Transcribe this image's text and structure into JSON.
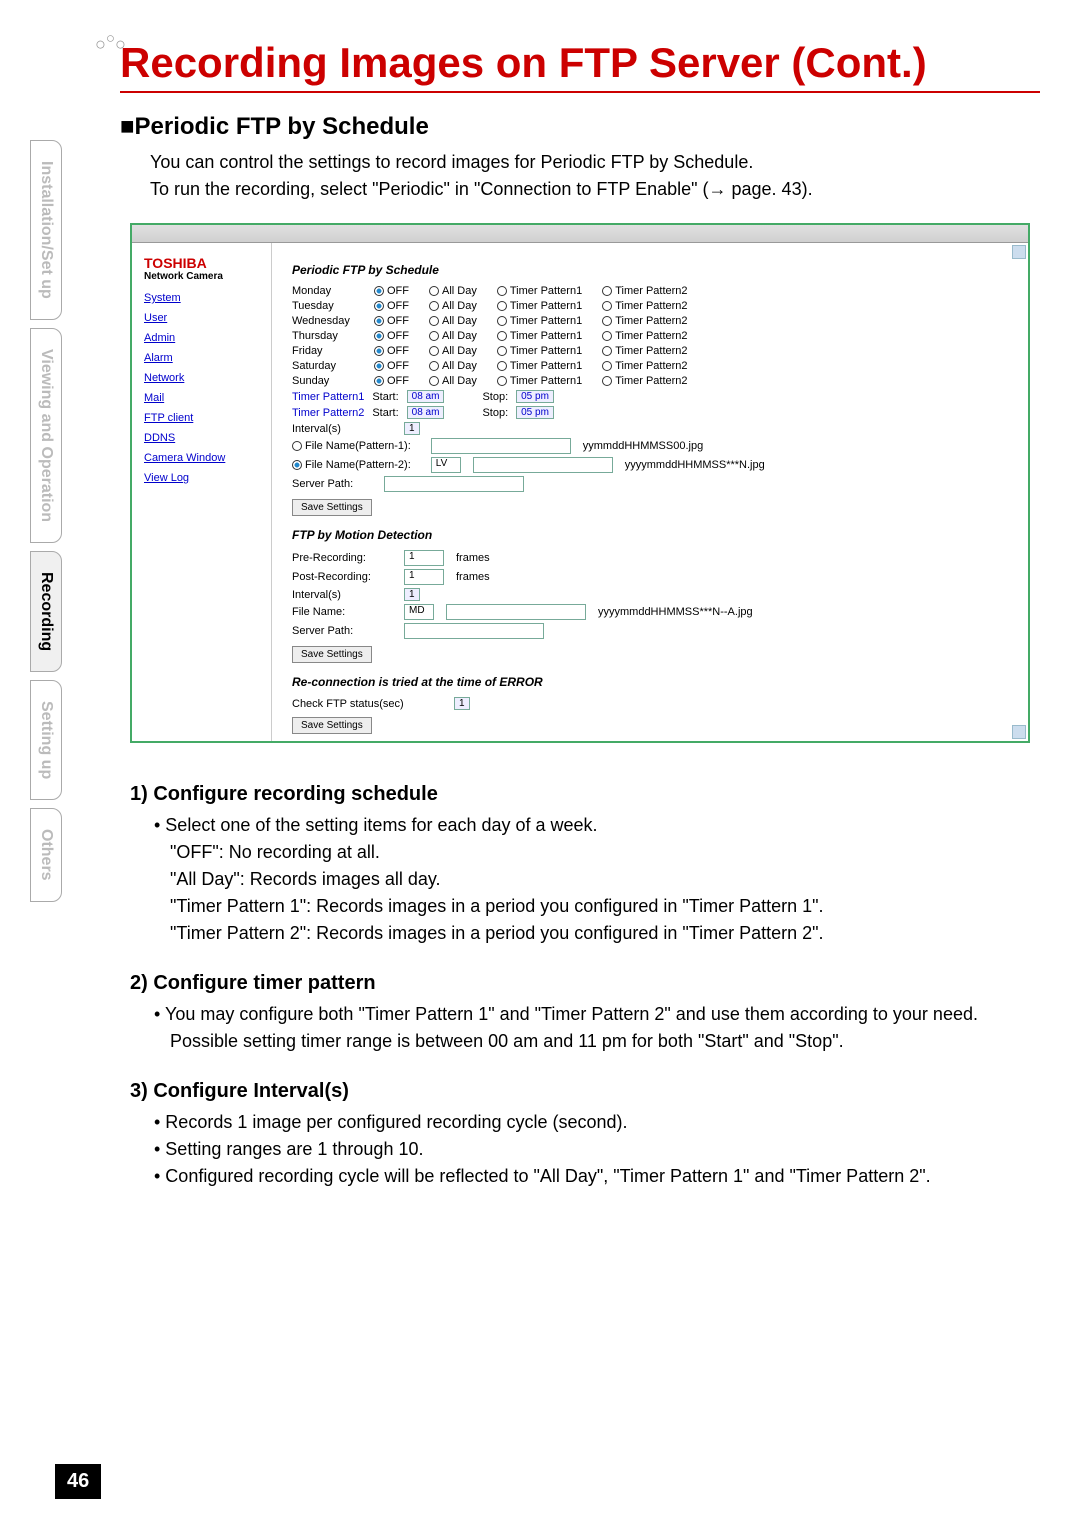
{
  "page_number": "46",
  "main_title": "Recording Images on FTP Server (Cont.)",
  "section_heading": "■Periodic FTP by Schedule",
  "intro_line1": "You can control the settings to record images for Periodic FTP by Schedule.",
  "intro_line2": "To run the recording, select \"Periodic\" in \"Connection to FTP Enable\" (→ page. 43).",
  "tabs": {
    "t1": "Installation/Set up",
    "t2": "Viewing and Operation",
    "t3": "Recording",
    "t4": "Setting up",
    "t5": "Others"
  },
  "ss": {
    "brand": "TOSHIBA",
    "subbrand": "Network Camera",
    "nav": [
      "System",
      "User",
      "Admin",
      "Alarm",
      "Network",
      "Mail",
      "FTP client",
      "DDNS",
      "Camera Window",
      "View Log"
    ],
    "sec1_title": "Periodic FTP by Schedule",
    "days": [
      "Monday",
      "Tuesday",
      "Wednesday",
      "Thursday",
      "Friday",
      "Saturday",
      "Sunday"
    ],
    "opts": [
      "OFF",
      "All Day",
      "Timer Pattern1",
      "Timer Pattern2"
    ],
    "tp1_label": "Timer Pattern1",
    "tp2_label": "Timer Pattern2",
    "start_label": "Start:",
    "stop_label": "Stop:",
    "start_val": "08 am",
    "stop_val": "05 pm",
    "interval_label": "Interval(s)",
    "interval_val": "1",
    "fnp1_label": "File Name(Pattern-1):",
    "fnp1_suffix": "yymmddHHMMSS00.jpg",
    "fnp2_label": "File Name(Pattern-2):",
    "fnp2_val": "LV",
    "fnp2_suffix": "yyyymmddHHMMSS***N.jpg",
    "server_path_label": "Server Path:",
    "save_btn": "Save Settings",
    "sec2_title": "FTP by Motion Detection",
    "pre_label": "Pre-Recording:",
    "pre_val": "1",
    "post_label": "Post-Recording:",
    "post_val": "1",
    "frames": "frames",
    "md_fn_label": "File Name:",
    "md_fn_val": "MD",
    "md_fn_suffix": "yyyymmddHHMMSS***N--A.jpg",
    "sec3_title": "Re-connection is tried at the time of ERROR",
    "check_ftp_label": "Check FTP status(sec)",
    "check_ftp_val": "1"
  },
  "steps": {
    "s1_title": "1) Configure recording schedule",
    "s1_b1": "• Select one of the setting items for each day of a week.",
    "s1_l1": "\"OFF\": No recording at all.",
    "s1_l2": "\"All Day\": Records images all day.",
    "s1_l3": "\"Timer Pattern 1\":  Records images in a period you configured in \"Timer Pattern 1\".",
    "s1_l4": "\"Timer Pattern 2\":  Records images in a period you configured in \"Timer Pattern 2\".",
    "s2_title": "2) Configure timer pattern",
    "s2_b1": "• You may configure both \"Timer Pattern 1\" and \"Timer Pattern 2\" and use them according to your need.",
    "s2_l1": "Possible setting timer range is between 00 am and 11 pm for both \"Start\" and \"Stop\".",
    "s3_title": "3) Configure Interval(s)",
    "s3_b1": "• Records 1 image per configured recording cycle (second).",
    "s3_b2": "• Setting ranges are 1 through 10.",
    "s3_b3": "• Configured recording cycle will be reflected to \"All Day\", \"Timer Pattern 1\" and \"Timer Pattern 2\"."
  }
}
